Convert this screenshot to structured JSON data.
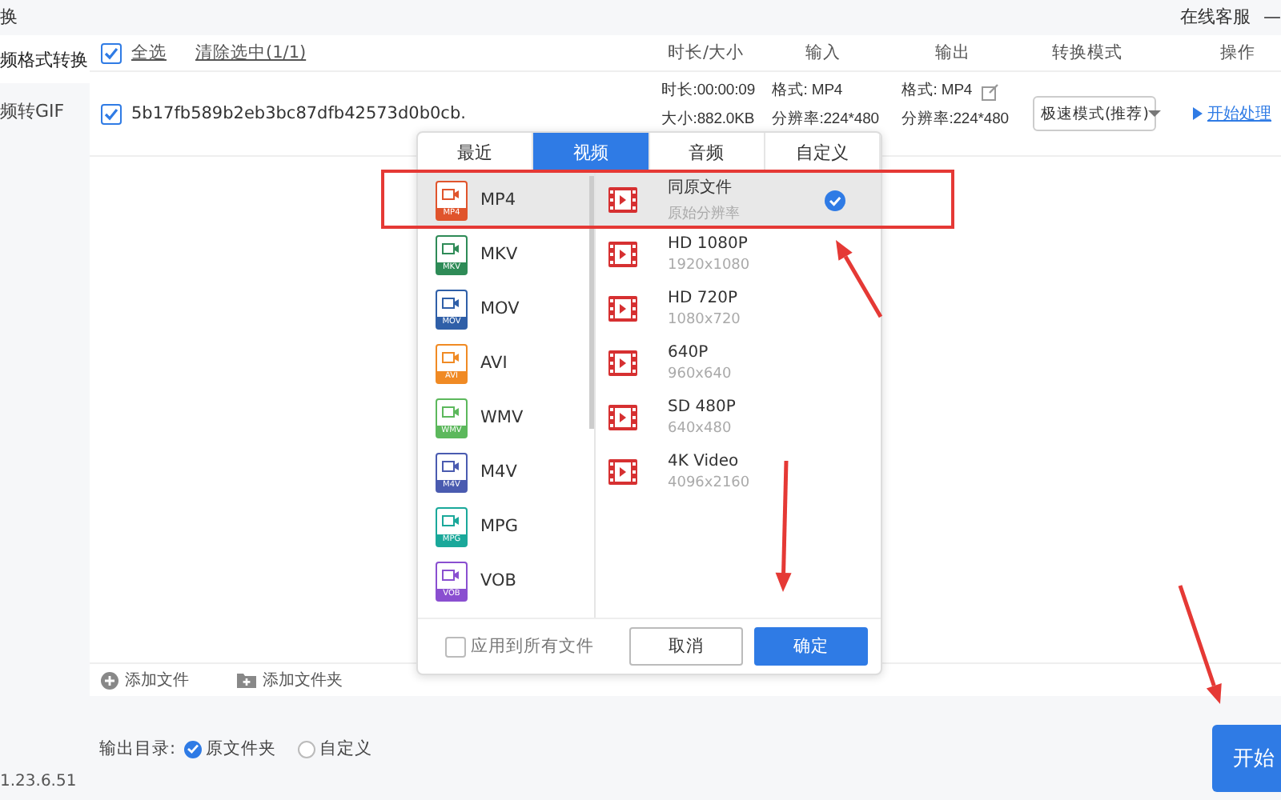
{
  "title_bar": {
    "title": "换",
    "support": "在线客服",
    "minimize": "—"
  },
  "sidebar": {
    "items": [
      {
        "label": "频格式转换",
        "selected": true
      },
      {
        "label": "频转GIF",
        "selected": false
      }
    ],
    "version": "1.23.6.51"
  },
  "file_list": {
    "select_all": {
      "label": "全选",
      "checked": true
    },
    "clear": "清除选中(1/1)",
    "columns": [
      "时长/大小",
      "输入",
      "输出",
      "转换模式",
      "操作"
    ],
    "rows": [
      {
        "checked": true,
        "name": "5b17fb589b2eb3bc87dfb42573d0b0cb.",
        "duration": "时长:00:00:09",
        "size": "大小:882.0KB",
        "input_format": "格式: MP4",
        "input_resolution": "分辨率:224*480",
        "output_format": "格式: MP4",
        "output_resolution": "分辨率:224*480",
        "mode": "极速模式(推荐)",
        "action": "开始处理"
      }
    ],
    "add_file": "添加文件",
    "add_folder": "添加文件夹"
  },
  "output": {
    "label": "输出目录:",
    "options": [
      {
        "label": "原文件夹",
        "selected": true
      },
      {
        "label": "自定义",
        "selected": false
      }
    ]
  },
  "start_button": "开始",
  "format_popup": {
    "tabs": [
      {
        "label": "最近",
        "selected": false
      },
      {
        "label": "视频",
        "selected": true
      },
      {
        "label": "音频",
        "selected": false
      },
      {
        "label": "自定义",
        "selected": false
      }
    ],
    "formats": [
      {
        "label": "MP4",
        "badge": "MP4",
        "color": "#e0542c",
        "selected": true
      },
      {
        "label": "MKV",
        "badge": "MKV",
        "color": "#2e8b57",
        "selected": false
      },
      {
        "label": "MOV",
        "badge": "MOV",
        "color": "#2f5fa8",
        "selected": false
      },
      {
        "label": "AVI",
        "badge": "AVI",
        "color": "#f08a24",
        "selected": false
      },
      {
        "label": "WMV",
        "badge": "WMV",
        "color": "#5cb85c",
        "selected": false
      },
      {
        "label": "M4V",
        "badge": "M4V",
        "color": "#4a5bb0",
        "selected": false
      },
      {
        "label": "MPG",
        "badge": "MPG",
        "color": "#1aa89a",
        "selected": false
      },
      {
        "label": "VOB",
        "badge": "VOB",
        "color": "#8a4fd0",
        "selected": false
      }
    ],
    "presets": [
      {
        "title": "同原文件",
        "subtitle": "原始分辨率",
        "selected": true
      },
      {
        "title": "HD 1080P",
        "subtitle": "1920x1080",
        "selected": false
      },
      {
        "title": "HD 720P",
        "subtitle": "1080x720",
        "selected": false
      },
      {
        "title": "640P",
        "subtitle": "960x640",
        "selected": false
      },
      {
        "title": "SD 480P",
        "subtitle": "640x480",
        "selected": false
      },
      {
        "title": "4K Video",
        "subtitle": "4096x2160",
        "selected": false
      }
    ],
    "apply_all": {
      "label": "应用到所有文件",
      "checked": false
    },
    "cancel": "取消",
    "confirm": "确定"
  }
}
